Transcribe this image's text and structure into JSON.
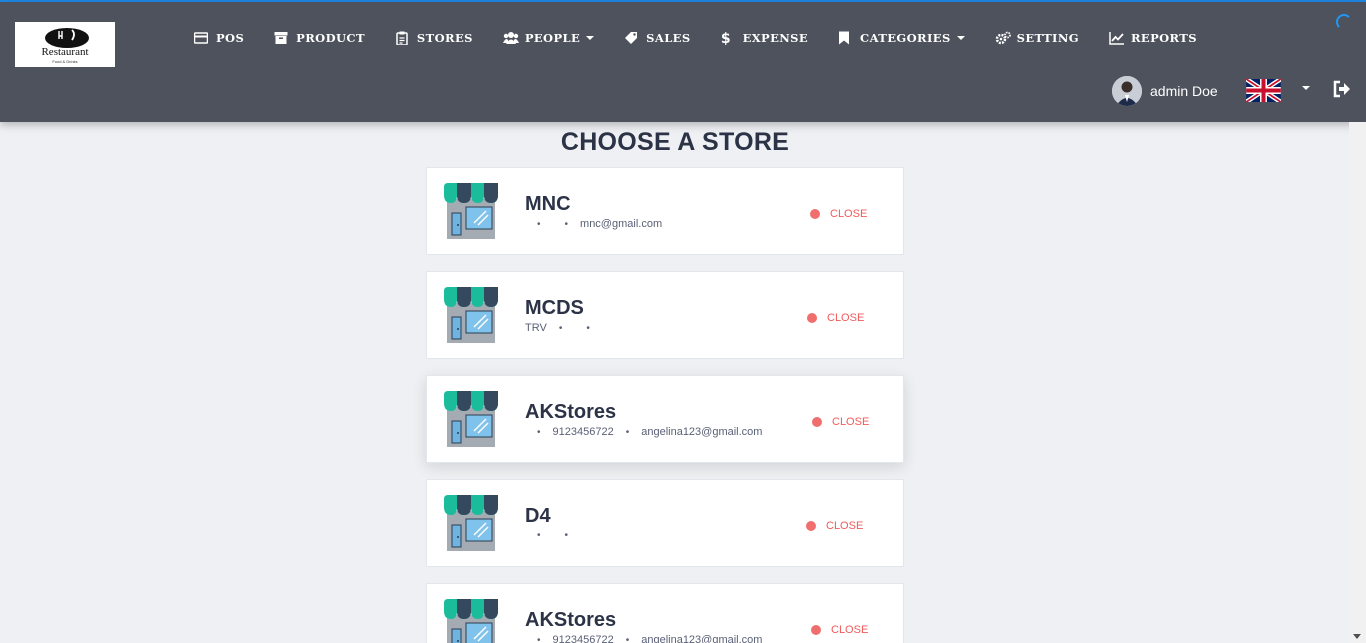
{
  "header": {
    "logo": {
      "text": "Restaurant",
      "subtext": "Food & Drinks"
    },
    "nav": [
      {
        "label": "POS",
        "icon": "credit-card-icon"
      },
      {
        "label": "PRODUCT",
        "icon": "archive-icon"
      },
      {
        "label": "STORES",
        "icon": "clipboard-icon"
      },
      {
        "label": "PEOPLE",
        "icon": "users-icon",
        "dropdown": true
      },
      {
        "label": "SALES",
        "icon": "tag-icon"
      },
      {
        "label": "EXPENSE",
        "icon": "dollar-icon"
      },
      {
        "label": "CATEGORIES",
        "icon": "bookmark-icon",
        "dropdown": true
      },
      {
        "label": "SETTING",
        "icon": "gears-icon"
      },
      {
        "label": "REPORTS",
        "icon": "line-chart-icon"
      }
    ],
    "user": {
      "name": "admin Doe"
    },
    "language": {
      "icon": "uk-flag-icon"
    },
    "logout_icon": "sign-out-icon"
  },
  "page": {
    "title": "CHOOSE A STORE",
    "stores": [
      {
        "name": "MNC",
        "phone": "",
        "email": "mnc@gmail.com",
        "prefix": "",
        "status": "CLOSE"
      },
      {
        "name": "MCDS",
        "phone": "",
        "email": "",
        "prefix": "TRV",
        "status": "CLOSE"
      },
      {
        "name": "AKStores",
        "phone": "9123456722",
        "email": "angelina123@gmail.com",
        "prefix": "",
        "status": "CLOSE"
      },
      {
        "name": "D4",
        "phone": "",
        "email": "",
        "prefix": "",
        "status": "CLOSE"
      },
      {
        "name": "AKStores",
        "phone": "9123456722",
        "email": "angelina123@gmail.com",
        "prefix": "",
        "status": "CLOSE"
      }
    ]
  },
  "colors": {
    "navbar": "#4d525c",
    "status_closed": "#f06e6e",
    "store_awning_green": "#1abc9c",
    "store_awning_dark": "#34495e"
  }
}
